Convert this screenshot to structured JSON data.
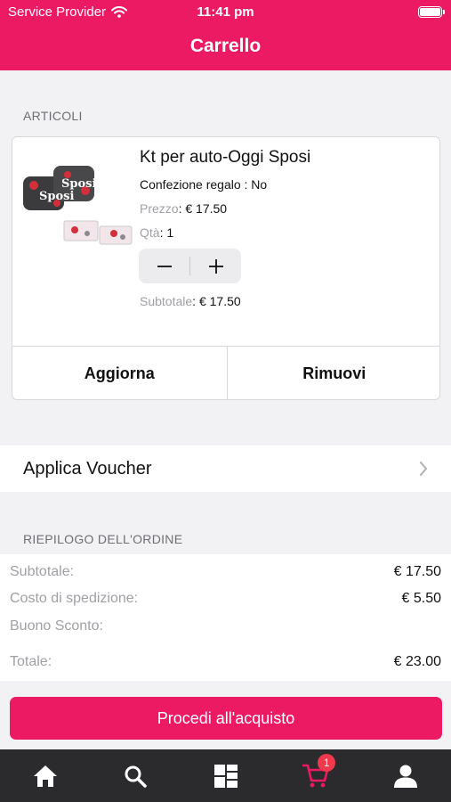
{
  "status_bar": {
    "carrier": "Service Provider",
    "time": "11:41 pm",
    "wifi_icon": "wifi-icon",
    "battery_icon": "battery-icon"
  },
  "header": {
    "title": "Carrello"
  },
  "articles": {
    "section_label": "ARTICOLI",
    "item": {
      "name": "Kt per auto-Oggi Sposi",
      "gift_wrap_label": "Confezione regalo",
      "gift_wrap_value": ": No",
      "price_label": "Prezzo",
      "price_value": ": € 17.50",
      "qty_label": "Qtà",
      "qty_value": ": 1",
      "subtotal_label": "Subtotale",
      "subtotal_value": ": € 17.50",
      "image_text": "Sposi"
    },
    "update_label": "Aggiorna",
    "remove_label": "Rimuovi"
  },
  "voucher": {
    "label": "Applica Voucher"
  },
  "summary": {
    "section_label": "RIEPILOGO DELL'ORDINE",
    "rows": [
      {
        "label": "Subtotale:",
        "value": "€ 17.50"
      },
      {
        "label": "Costo di spedizione:",
        "value": "€ 5.50"
      },
      {
        "label": "Buono Sconto:",
        "value": ""
      },
      {
        "label": "Totale:",
        "value": "€ 23.00"
      }
    ]
  },
  "checkout": {
    "label": "Procedi all'acquisto"
  },
  "tabbar": {
    "items": [
      {
        "icon": "home-icon"
      },
      {
        "icon": "search-icon"
      },
      {
        "icon": "categories-icon"
      },
      {
        "icon": "cart-icon",
        "badge": "1",
        "active": true
      },
      {
        "icon": "profile-icon"
      }
    ]
  },
  "colors": {
    "accent": "#ec1a63",
    "tabbar_bg": "#2b2b2d",
    "badge": "#f0394c"
  }
}
